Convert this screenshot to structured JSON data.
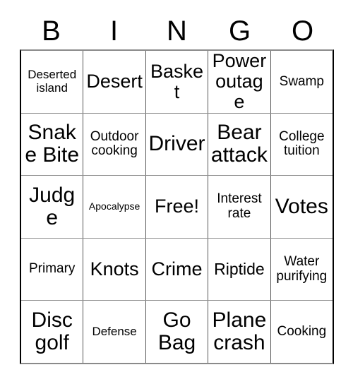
{
  "card": {
    "title": "BINGO Card",
    "header_letters": [
      "B",
      "I",
      "N",
      "G",
      "O"
    ],
    "grid_size": "5x5",
    "text_color": "#000000",
    "background_color": "#ffffff",
    "border_color": "#000000",
    "rows": [
      [
        {
          "label": "Deserted island",
          "size": "fs-s",
          "free": false
        },
        {
          "label": "Desert",
          "size": "fs-xl",
          "free": false
        },
        {
          "label": "Basket",
          "size": "fs-xl",
          "free": false
        },
        {
          "label": "Power outage",
          "size": "fs-xl",
          "free": false
        },
        {
          "label": "Swamp",
          "size": "fs-m",
          "free": false
        }
      ],
      [
        {
          "label": "Snake Bite",
          "size": "fs-xxl",
          "free": false
        },
        {
          "label": "Outdoor cooking",
          "size": "fs-m",
          "free": false
        },
        {
          "label": "Driver",
          "size": "fs-xxl",
          "free": false
        },
        {
          "label": "Bear attack",
          "size": "fs-xxl",
          "free": false
        },
        {
          "label": "College tuition",
          "size": "fs-m",
          "free": false
        }
      ],
      [
        {
          "label": "Judge",
          "size": "fs-xxl",
          "free": false
        },
        {
          "label": "Apocalypse",
          "size": "fs-xs",
          "free": false
        },
        {
          "label": "Free!",
          "size": "fs-xl",
          "free": true
        },
        {
          "label": "Interest rate",
          "size": "fs-m",
          "free": false
        },
        {
          "label": "Votes",
          "size": "fs-xxl",
          "free": false
        }
      ],
      [
        {
          "label": "Primary",
          "size": "fs-m",
          "free": false
        },
        {
          "label": "Knots",
          "size": "fs-xl",
          "free": false
        },
        {
          "label": "Crime",
          "size": "fs-xl",
          "free": false
        },
        {
          "label": "Riptide",
          "size": "fs-l",
          "free": false
        },
        {
          "label": "Water purifying",
          "size": "fs-m",
          "free": false
        }
      ],
      [
        {
          "label": "Disc golf",
          "size": "fs-xxl",
          "free": false
        },
        {
          "label": "Defense",
          "size": "fs-s",
          "free": false
        },
        {
          "label": "Go Bag",
          "size": "fs-xxl",
          "free": false
        },
        {
          "label": "Plane crash",
          "size": "fs-xxl",
          "free": false
        },
        {
          "label": "Cooking",
          "size": "fs-m",
          "free": false
        }
      ]
    ]
  }
}
